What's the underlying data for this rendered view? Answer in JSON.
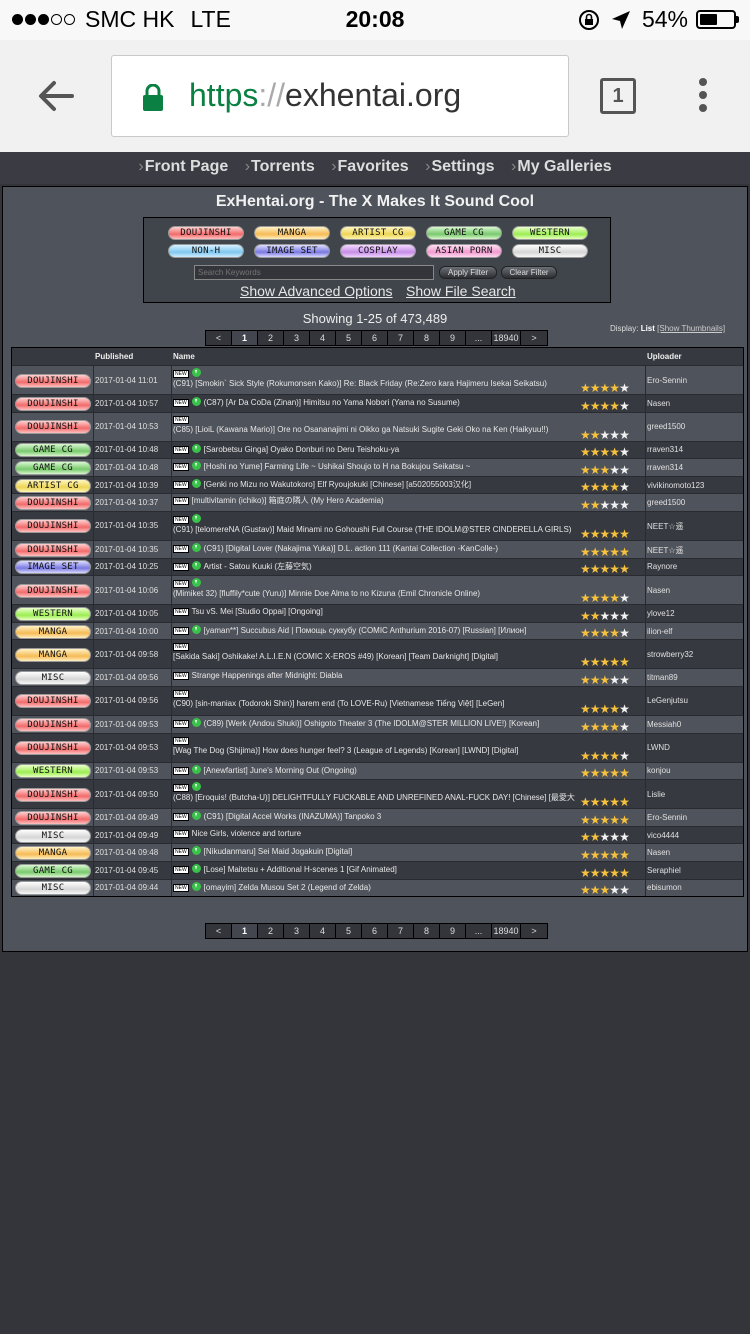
{
  "statusbar": {
    "carrier": "SMC HK",
    "network": "LTE",
    "time": "20:08",
    "battery": "54%",
    "battery_level": 0.54
  },
  "browser": {
    "url_protocol": "https",
    "url_sep": "://",
    "url_host": "exhentai.org",
    "tab_count": "1"
  },
  "nav": [
    "Front Page",
    "Torrents",
    "Favorites",
    "Settings",
    "My Galleries"
  ],
  "site_title": "ExHentai.org - The X Makes It Sound Cool",
  "categories": [
    "DOUJINSHI",
    "MANGA",
    "ARTIST CG",
    "GAME CG",
    "WESTERN",
    "NON-H",
    "IMAGE SET",
    "COSPLAY",
    "ASIAN PORN",
    "MISC"
  ],
  "search": {
    "placeholder": "Search Keywords",
    "apply": "Apply Filter",
    "clear": "Clear Filter"
  },
  "advanced_link": "Show Advanced Options",
  "file_search_link": "Show File Search",
  "showing": "Showing 1-25 of 473,489",
  "display": {
    "label": "Display:",
    "current": "List",
    "alt": "[Show Thumbnails]"
  },
  "pager": [
    "<",
    "1",
    "2",
    "3",
    "4",
    "5",
    "6",
    "7",
    "8",
    "9",
    "...",
    "18940",
    ">"
  ],
  "table_headers": {
    "published": "Published",
    "name": "Name",
    "uploader": "Uploader"
  },
  "rows": [
    {
      "category": "DOUJINSHI",
      "published": "2017-01-04 11:01",
      "title": "(C91) [Smokin` Sick Style (Rokumonsen Kako)] Re: Black Friday (Re:Zero kara Hajimeru Isekai Seikatsu)",
      "rating": 4,
      "uploader": "Ero-Sennin",
      "dl": true
    },
    {
      "category": "DOUJINSHI",
      "published": "2017-01-04 10:57",
      "title": "(C87) [Ar Da CoDa (Zinan)] Himitsu no Yama Nobori (Yama no Susume)",
      "rating": 4,
      "uploader": "Nasen",
      "dl": true
    },
    {
      "category": "DOUJINSHI",
      "published": "2017-01-04 10:53",
      "title": "(C85) [LioiL (Kawana Mario)] Ore no Osananajimi ni Oikko ga Natsuki Sugite Geki Oko na Ken (Haikyuu!!)",
      "rating": 1.5,
      "uploader": "greed1500",
      "dl": false
    },
    {
      "category": "GAME CG",
      "published": "2017-01-04 10:48",
      "title": "[Sarobetsu Ginga] Oyako Donburi no Deru Teishoku-ya",
      "rating": 4,
      "uploader": "rraven314",
      "dl": true
    },
    {
      "category": "GAME CG",
      "published": "2017-01-04 10:48",
      "title": "[Hoshi no Yume] Farming Life ~ Ushikai Shoujo to H na Bokujou Seikatsu ~",
      "rating": 2.5,
      "uploader": "rraven314",
      "dl": true
    },
    {
      "category": "ARTIST CG",
      "published": "2017-01-04 10:39",
      "title": "[Genki no Mizu no Wakutokoro] Elf Ryoujokuki [Chinese] [a502055003汉化]",
      "rating": 4,
      "uploader": "vivikinomoto123",
      "dl": true
    },
    {
      "category": "DOUJINSHI",
      "published": "2017-01-04 10:37",
      "title": "[multivitamin (ichiko)] 箱庭の隣人 (My Hero Academia)",
      "rating": 1.5,
      "uploader": "greed1500",
      "dl": false
    },
    {
      "category": "DOUJINSHI",
      "published": "2017-01-04 10:35",
      "title": "(C91) [telomereNA (Gustav)] Maid Minami no Gohoushi Full Course (THE IDOLM@STER CINDERELLA GIRLS)",
      "rating": 5,
      "uploader": "NEET☆遥",
      "dl": true
    },
    {
      "category": "DOUJINSHI",
      "published": "2017-01-04 10:35",
      "title": "(C91) [Digital Lover (Nakajima Yuka)] D.L. action 111 (Kantai Collection -KanColle-)",
      "rating": 5,
      "uploader": "NEET☆遥",
      "dl": true
    },
    {
      "category": "IMAGE SET",
      "published": "2017-01-04 10:25",
      "title": "Artist - Satou Kuuki (左藤空気)",
      "rating": 5,
      "uploader": "Raynore",
      "dl": true
    },
    {
      "category": "DOUJINSHI",
      "published": "2017-01-04 10:06",
      "title": "(Mimiket 32) [fluffily*cute (Yuru)] Minnie Doe Alma to no Kizuna (Emil Chronicle Online)",
      "rating": 4,
      "uploader": "Nasen",
      "dl": true
    },
    {
      "category": "WESTERN",
      "published": "2017-01-04 10:05",
      "title": "Tsu vS. Mei [Studio Oppai] [Ongoing]",
      "rating": 1.5,
      "uploader": "ylove12",
      "dl": false
    },
    {
      "category": "MANGA",
      "published": "2017-01-04 10:00",
      "title": "[yaman**] Succubus Aid | Помощь суккубу (COMIC Anthurium 2016-07) [Russian] [Илион]",
      "rating": 4,
      "uploader": "ilion-elf",
      "dl": true
    },
    {
      "category": "MANGA",
      "published": "2017-01-04 09:58",
      "title": "[Sakida Saki] Oshikake! A.L.I.E.N (COMIC X-EROS #49) [Korean] [Team Darknight] [Digital]",
      "rating": 5,
      "uploader": "strowberry32",
      "dl": false
    },
    {
      "category": "MISC",
      "published": "2017-01-04 09:56",
      "title": "Strange Happenings after Midnight: Diabla",
      "rating": 2.5,
      "uploader": "titman89",
      "dl": false
    },
    {
      "category": "DOUJINSHI",
      "published": "2017-01-04 09:56",
      "title": "(C90) [sin-maniax (Todoroki Shin)] harem end (To LOVE-Ru) [Vietnamese Tiếng Việt] [LeGen]",
      "rating": 4,
      "uploader": "LeGenjutsu",
      "dl": false
    },
    {
      "category": "DOUJINSHI",
      "published": "2017-01-04 09:53",
      "title": "(C89) [Werk (Andou Shuki)] Oshigoto Theater 3 (The IDOLM@STER MILLION LIVE!) [Korean]",
      "rating": 4,
      "uploader": "Messiah0",
      "dl": true
    },
    {
      "category": "DOUJINSHI",
      "published": "2017-01-04 09:53",
      "title": "[Wag The Dog (Shijima)] How does hunger feel? 3 (League of Legends) [Korean] [LWND] [Digital]",
      "rating": 4,
      "uploader": "LWND",
      "dl": false
    },
    {
      "category": "WESTERN",
      "published": "2017-01-04 09:53",
      "title": "[Anewfartist] June's Morning Out (Ongoing)",
      "rating": 5,
      "uploader": "konjou",
      "dl": true
    },
    {
      "category": "DOUJINSHI",
      "published": "2017-01-04 09:50",
      "title": "(C88) [Eroquis! (Butcha-U)] DELIGHTFULLY FUCKABLE AND UNREFINED ANAL-FUCK DAY! [Chinese] [最愛大",
      "rating": 5,
      "uploader": "Lislie",
      "dl": true
    },
    {
      "category": "DOUJINSHI",
      "published": "2017-01-04 09:49",
      "title": "(C91) [Digital Accel Works (INAZUMA)] Tanpoko 3",
      "rating": 5,
      "uploader": "Ero-Sennin",
      "dl": true
    },
    {
      "category": "MISC",
      "published": "2017-01-04 09:49",
      "title": "Nice Girls, violence and torture",
      "rating": 1.5,
      "uploader": "vico4444",
      "dl": false
    },
    {
      "category": "MANGA",
      "published": "2017-01-04 09:48",
      "title": "[Nikudanmaru] Sei Maid Jogakuin [Digital]",
      "rating": 5,
      "uploader": "Nasen",
      "dl": true
    },
    {
      "category": "GAME CG",
      "published": "2017-01-04 09:45",
      "title": "[Lose] Maitetsu + Additional H-scenes 1 [Gif Animated]",
      "rating": 5,
      "uploader": "Seraphiel",
      "dl": true
    },
    {
      "category": "MISC",
      "published": "2017-01-04 09:44",
      "title": "[omayim] Zelda Musou Set 2 (Legend of Zelda)",
      "rating": 2.5,
      "uploader": "ebisumon",
      "dl": true
    }
  ]
}
